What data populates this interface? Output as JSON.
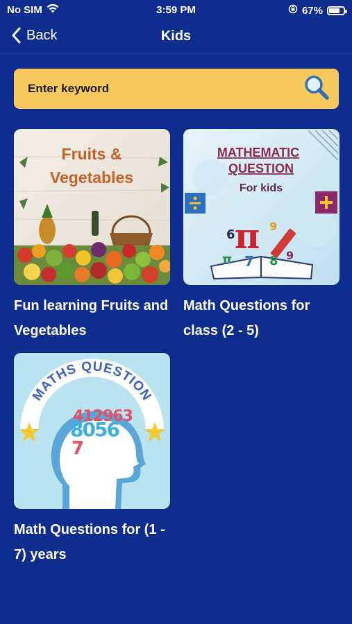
{
  "status": {
    "carrier": "No SIM",
    "time": "3:59 PM",
    "battery": "67%",
    "battery_level": 0.67
  },
  "nav": {
    "back_label": "Back",
    "title": "Kids"
  },
  "search": {
    "placeholder": "Enter keyword"
  },
  "cards": [
    {
      "title": "Fun learning Fruits and Vegetables",
      "image_text": [
        "Fruits &",
        "Vegetables"
      ]
    },
    {
      "title": "Math Questions for class (2 - 5)",
      "image_text": [
        "MATHEMATIC",
        "QUESTION",
        "For kids"
      ]
    },
    {
      "title": "Math Questions for (1 - 7) years",
      "image_text": [
        "MATHS QUESTION",
        "412963",
        "8056",
        "7"
      ]
    }
  ],
  "colors": {
    "background": "#0f2d8e",
    "search": "#f7c95c"
  }
}
